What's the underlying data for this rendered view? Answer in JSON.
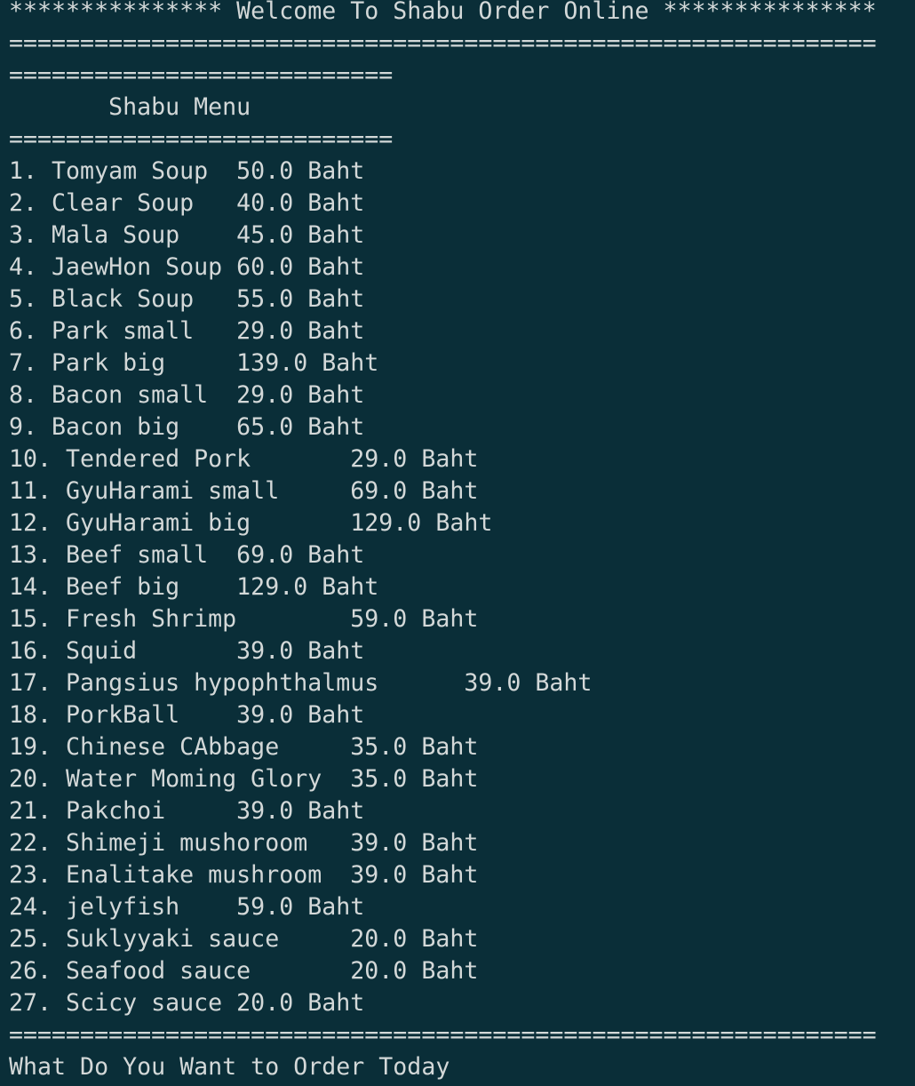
{
  "terminal": {
    "lines": [
      "*************** Welcome To Shabu Order Online ***************",
      "=============================================================",
      "===========================",
      "       Shabu Menu",
      "===========================",
      "1. Tomyam Soup  50.0 Baht",
      "2. Clear Soup   40.0 Baht",
      "3. Mala Soup    45.0 Baht",
      "4. JaewHon Soup 60.0 Baht",
      "5. Black Soup   55.0 Baht",
      "6. Park small   29.0 Baht",
      "7. Park big     139.0 Baht",
      "8. Bacon small  29.0 Baht",
      "9. Bacon big    65.0 Baht",
      "10. Tendered Pork       29.0 Baht",
      "11. GyuHarami small     69.0 Baht",
      "12. GyuHarami big       129.0 Baht",
      "13. Beef small  69.0 Baht",
      "14. Beef big    129.0 Baht",
      "15. Fresh Shrimp        59.0 Baht",
      "16. Squid       39.0 Baht",
      "17. Pangsius hypophthalmus      39.0 Baht",
      "18. PorkBall    39.0 Baht",
      "19. Chinese CAbbage     35.0 Baht",
      "20. Water Moming Glory  35.0 Baht",
      "21. Pakchoi     39.0 Baht",
      "22. Shimeji mushoroom   39.0 Baht",
      "23. Enalitake mushroom  39.0 Baht",
      "24. jelyfish    59.0 Baht",
      "25. Suklyyaki sauce     20.0 Baht",
      "26. Seafood sauce       20.0 Baht",
      "27. Scicy sauce 20.0 Baht",
      "=============================================================",
      "What Do You Want to Order Today"
    ]
  },
  "colors": {
    "background": "#0a2e38",
    "foreground": "#d3d8d8"
  }
}
